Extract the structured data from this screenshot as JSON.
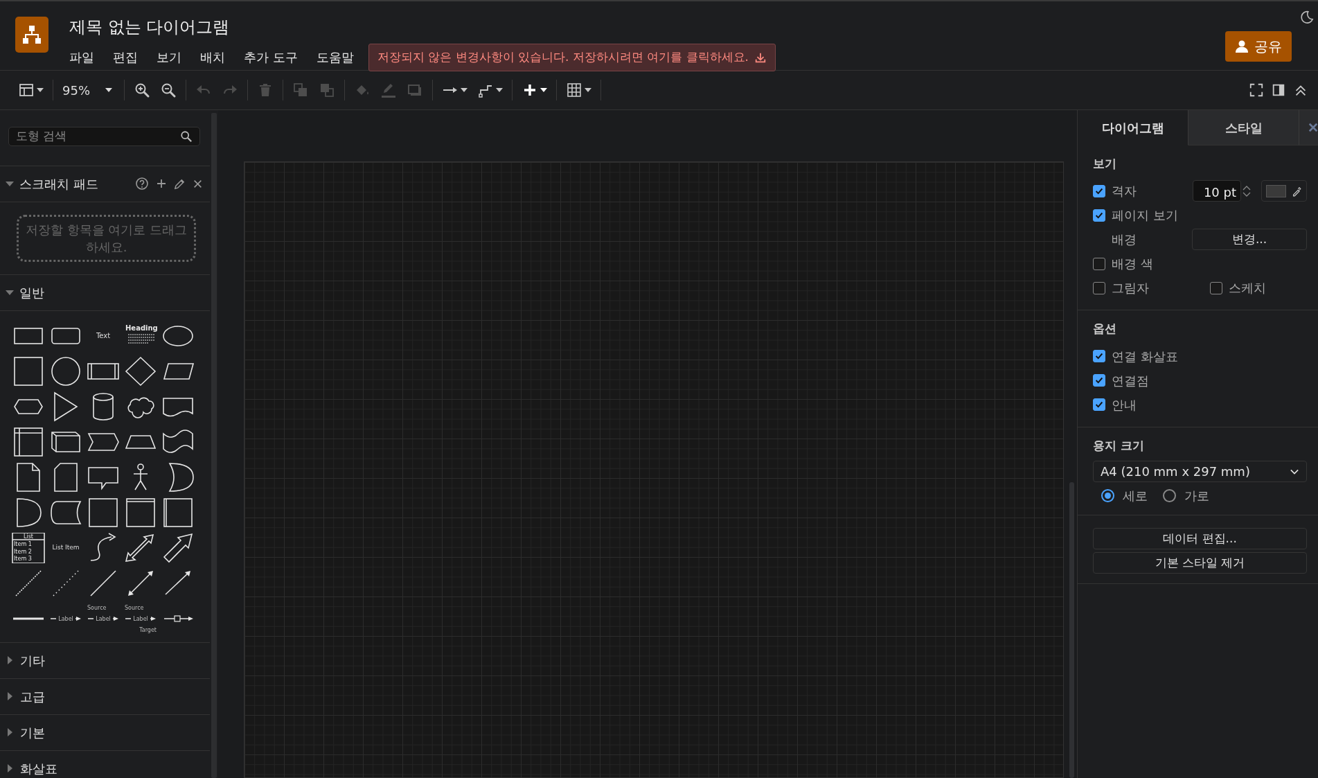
{
  "app": {
    "title": "제목 없는 다이어그램",
    "menu": [
      {
        "label": "파일"
      },
      {
        "label": "편집"
      },
      {
        "label": "보기"
      },
      {
        "label": "배치"
      },
      {
        "label": "추가 도구"
      },
      {
        "label": "도움말"
      }
    ],
    "notice": "저장되지 않은 변경사항이 있습니다. 저장하시려면 여기를 클릭하세요.",
    "share_button": "공유"
  },
  "toolbar_groups": [
    {
      "items": [
        {
          "kind": "layout",
          "dropdown": true,
          "disabled": false
        }
      ]
    },
    {
      "items": [
        {
          "kind": "zoom-level",
          "label": "95%",
          "dropdown": true,
          "disabled": false
        }
      ]
    },
    {
      "items": [
        {
          "kind": "zoom-in",
          "dropdown": false,
          "disabled": false
        },
        {
          "kind": "zoom-out",
          "dropdown": false,
          "disabled": false
        }
      ]
    },
    {
      "items": [
        {
          "kind": "undo",
          "dropdown": false,
          "disabled": true
        },
        {
          "kind": "redo",
          "dropdown": false,
          "disabled": true
        }
      ]
    },
    {
      "items": [
        {
          "kind": "delete",
          "dropdown": false,
          "disabled": true
        }
      ]
    },
    {
      "items": [
        {
          "kind": "to-front",
          "dropdown": false,
          "disabled": true
        },
        {
          "kind": "to-back",
          "dropdown": false,
          "disabled": true
        }
      ]
    },
    {
      "items": [
        {
          "kind": "fill",
          "dropdown": false,
          "disabled": true
        },
        {
          "kind": "line-color",
          "dropdown": false,
          "disabled": true
        },
        {
          "kind": "shadow",
          "dropdown": false,
          "disabled": true
        }
      ]
    },
    {
      "items": [
        {
          "kind": "connection",
          "dropdown": true,
          "disabled": false
        },
        {
          "kind": "waypoints",
          "dropdown": true,
          "disabled": false
        }
      ]
    },
    {
      "items": [
        {
          "kind": "insert",
          "dropdown": true,
          "disabled": false
        }
      ]
    },
    {
      "items": [
        {
          "kind": "table",
          "dropdown": true,
          "disabled": false
        }
      ]
    }
  ],
  "view_controls": [
    {
      "kind": "fullscreen"
    },
    {
      "kind": "format-panel"
    },
    {
      "kind": "collapse"
    }
  ],
  "sidebar": {
    "search": {
      "placeholder": "도형 검색"
    },
    "scratchpad": {
      "title": "스크래치 패드",
      "expanded": true,
      "hint": "저장할 항목을 여기로 드래그하세요."
    },
    "sections": [
      {
        "title": "일반",
        "expanded": true,
        "shapes": [
          {
            "kind": "rectangle"
          },
          {
            "kind": "rounded-rectangle"
          },
          {
            "kind": "text",
            "label": "Text"
          },
          {
            "kind": "heading",
            "label": "Heading"
          },
          {
            "kind": "ellipse"
          },
          {
            "kind": "square"
          },
          {
            "kind": "circle"
          },
          {
            "kind": "process"
          },
          {
            "kind": "diamond"
          },
          {
            "kind": "parallelogram"
          },
          {
            "kind": "hexagon"
          },
          {
            "kind": "triangle"
          },
          {
            "kind": "cylinder"
          },
          {
            "kind": "cloud"
          },
          {
            "kind": "document"
          },
          {
            "kind": "internal-storage"
          },
          {
            "kind": "cube"
          },
          {
            "kind": "step"
          },
          {
            "kind": "trapezoid"
          },
          {
            "kind": "tape"
          },
          {
            "kind": "note"
          },
          {
            "kind": "card"
          },
          {
            "kind": "callout"
          },
          {
            "kind": "actor"
          },
          {
            "kind": "or"
          },
          {
            "kind": "and"
          },
          {
            "kind": "data-storage"
          },
          {
            "kind": "container"
          },
          {
            "kind": "titled-container"
          },
          {
            "kind": "side-container"
          },
          {
            "kind": "list",
            "label": "List",
            "items": [
              "Item 1",
              "Item 2",
              "Item 3"
            ]
          },
          {
            "kind": "list-item",
            "label": "List Item"
          },
          {
            "kind": "curved-arrow"
          },
          {
            "kind": "double-block-arrow"
          },
          {
            "kind": "block-arrow"
          },
          {
            "kind": "dashed-line"
          },
          {
            "kind": "dotted-line"
          },
          {
            "kind": "line"
          },
          {
            "kind": "bidirectional-arrow"
          },
          {
            "kind": "directional-arrow"
          },
          {
            "kind": "thick-line"
          },
          {
            "kind": "labeled-connector",
            "label": "Label"
          },
          {
            "kind": "source-connector",
            "source": "Source",
            "label": "Label"
          },
          {
            "kind": "source-target-connector",
            "source": "Source",
            "label": "Label",
            "target": "Target"
          },
          {
            "kind": "boxed-connector"
          }
        ]
      },
      {
        "title": "기타",
        "expanded": false
      },
      {
        "title": "고급",
        "expanded": false
      },
      {
        "title": "기본",
        "expanded": false
      },
      {
        "title": "화살표",
        "expanded": false
      }
    ]
  },
  "format_panel": {
    "tabs": [
      {
        "label": "다이어그램",
        "selected": true
      },
      {
        "label": "스타일",
        "selected": false
      }
    ],
    "view": {
      "title": "보기",
      "grid": {
        "label": "격자",
        "checked": true,
        "size": "10 pt"
      },
      "page_view": {
        "label": "페이지 보기",
        "checked": true
      },
      "background": {
        "label": "배경",
        "button": "변경..."
      },
      "background_color": {
        "label": "배경 색",
        "checked": false
      },
      "shadow": {
        "label": "그림자",
        "checked": false
      },
      "sketch": {
        "label": "스케치",
        "checked": false
      }
    },
    "options": {
      "title": "옵션",
      "items": [
        {
          "label": "연결 화살표",
          "checked": true
        },
        {
          "label": "연결점",
          "checked": true
        },
        {
          "label": "안내",
          "checked": true
        }
      ]
    },
    "paper": {
      "title": "용지 크기",
      "size": "A4 (210 mm x 297 mm)",
      "orientations": [
        {
          "label": "세로",
          "selected": true
        },
        {
          "label": "가로",
          "selected": false
        }
      ]
    },
    "buttons": [
      "데이터 편집...",
      "기본 스타일 제거"
    ]
  }
}
